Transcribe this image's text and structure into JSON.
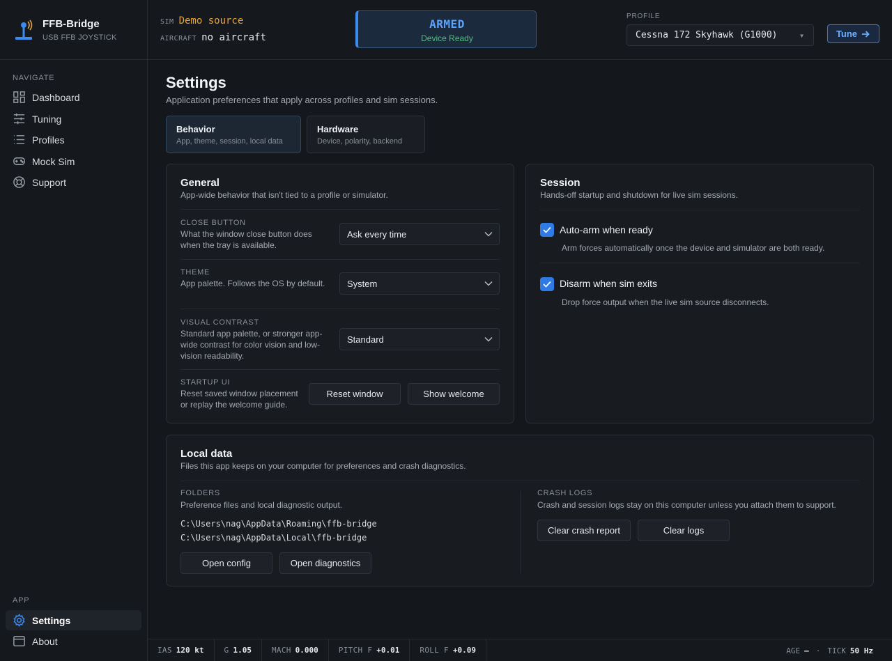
{
  "brand": {
    "name": "FFB-Bridge",
    "subtitle": "USB FFB JOYSTICK"
  },
  "sidebar": {
    "navigate_label": "NAVIGATE",
    "items": [
      {
        "label": "Dashboard",
        "icon": "dashboard-icon"
      },
      {
        "label": "Tuning",
        "icon": "sliders-icon"
      },
      {
        "label": "Profiles",
        "icon": "list-icon"
      },
      {
        "label": "Mock Sim",
        "icon": "gamepad-icon"
      },
      {
        "label": "Support",
        "icon": "lifebuoy-icon"
      }
    ],
    "app_label": "APP",
    "app_items": [
      {
        "label": "Settings",
        "icon": "gear-icon",
        "active": true
      },
      {
        "label": "About",
        "icon": "window-icon"
      }
    ]
  },
  "header": {
    "sim_key": "SIM",
    "sim_value": "Demo source",
    "aircraft_key": "AIRCRAFT",
    "aircraft_value": "no aircraft",
    "status_title": "ARMED",
    "status_sub": "Device Ready",
    "profile_label": "PROFILE",
    "profile_value": "Cessna 172 Skyhawk (G1000)",
    "tune_label": "Tune"
  },
  "page": {
    "title": "Settings",
    "subtitle": "Application preferences that apply across profiles and sim sessions.",
    "tabs": [
      {
        "title": "Behavior",
        "sub": "App, theme, session, local data"
      },
      {
        "title": "Hardware",
        "sub": "Device, polarity, backend"
      }
    ]
  },
  "general": {
    "title": "General",
    "subtitle": "App-wide behavior that isn't tied to a profile or simulator.",
    "close_button": {
      "key": "CLOSE BUTTON",
      "desc": "What the window close button does when the tray is available.",
      "value": "Ask every time"
    },
    "theme": {
      "key": "THEME",
      "desc": "App palette. Follows the OS by default.",
      "value": "System"
    },
    "contrast": {
      "key": "VISUAL CONTRAST",
      "desc": "Standard app palette, or stronger app-wide contrast for color vision and low-vision readability.",
      "value": "Standard"
    },
    "startup": {
      "key": "STARTUP UI",
      "desc": "Reset saved window placement or replay the welcome guide.",
      "reset_label": "Reset window",
      "welcome_label": "Show welcome"
    }
  },
  "session": {
    "title": "Session",
    "subtitle": "Hands-off startup and shutdown for live sim sessions.",
    "auto_arm": {
      "label": "Auto-arm when ready",
      "desc": "Arm forces automatically once the device and simulator are both ready."
    },
    "disarm": {
      "label": "Disarm when sim exits",
      "desc": "Drop force output when the live sim source disconnects."
    }
  },
  "local_data": {
    "title": "Local data",
    "subtitle": "Files this app keeps on your computer for preferences and crash diagnostics.",
    "folders": {
      "key": "FOLDERS",
      "desc": "Preference files and local diagnostic output.",
      "path1": "C:\\Users\\nag\\AppData\\Roaming\\ffb-bridge",
      "path2": "C:\\Users\\nag\\AppData\\Local\\ffb-bridge",
      "open_config": "Open config",
      "open_diag": "Open diagnostics"
    },
    "crash": {
      "key": "CRASH LOGS",
      "desc": "Crash and session logs stay on this computer unless you attach them to support.",
      "clear_report": "Clear crash report",
      "clear_logs": "Clear logs"
    }
  },
  "statusbar": {
    "ias_k": "IAS",
    "ias_v": "120 kt",
    "g_k": "G",
    "g_v": "1.05",
    "mach_k": "MACH",
    "mach_v": "0.000",
    "pitch_k": "PITCH F",
    "pitch_v": "+0.01",
    "roll_k": "ROLL F",
    "roll_v": "+0.09",
    "age_k": "AGE",
    "age_v": "—",
    "sep": "·",
    "tick_k": "TICK",
    "tick_v": "50 Hz"
  },
  "colors": {
    "accent": "#3d8bef",
    "sim": "#e8a33c",
    "ready": "#4cc37a",
    "bg": "#14171c"
  }
}
